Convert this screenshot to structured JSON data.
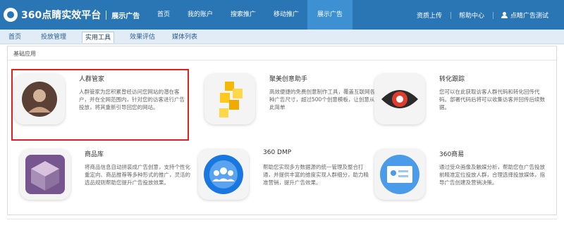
{
  "header": {
    "brand": "360点睛实效平台",
    "sub_brand": "展示广告",
    "nav": [
      {
        "label": "首页"
      },
      {
        "label": "我的账户"
      },
      {
        "label": "搜索推广"
      },
      {
        "label": "移动推广"
      },
      {
        "label": "展示广告",
        "active": true
      }
    ],
    "right": {
      "upload_label": "资质上传",
      "help_label": "帮助中心",
      "user_label": "点睛广告测试"
    }
  },
  "subnav": {
    "items": [
      {
        "label": "首页"
      },
      {
        "label": "投放管理"
      },
      {
        "label": "实用工具",
        "active": true
      },
      {
        "label": "效果评估"
      },
      {
        "label": "媒体列表"
      }
    ]
  },
  "section": {
    "title": "基础应用",
    "cards": [
      {
        "title": "人群管家",
        "icon": "person-avatar-icon",
        "desc": "人群管家为您积累曾经访问您网站的潜在客户，并在全网范围内，针对您的访客进行广告投放，将其重新引导回您的网站。"
      },
      {
        "title": "聚美创意助手",
        "icon": "puzzle-blocks-icon",
        "desc": "高效便捷的免费创意制作工具，覆盖互联网各种广告尺寸，超过500个创意模板，让创意从此简单"
      },
      {
        "title": "转化跟踪",
        "icon": "eye-icon",
        "desc": "您可以在此获取访客人群代码和转化回传代码。部署代码后将可以收集访客并回传后续数据。"
      },
      {
        "title": "商品库",
        "icon": "cube-box-icon",
        "desc": "将商品信息自动拼装成广告创意，支持个性化重定向、商品推荐等多种形式的推广，灵活的选品规则帮助您提升广告投放效果。"
      },
      {
        "title": "360 DMP",
        "icon": "people-group-icon",
        "desc": "帮助您实现多方数据源的统一管理及整合打通，并提供丰富的维度实现人群细分，助力精准营销，提升广告效果。"
      },
      {
        "title": "360商易",
        "icon": "id-card-icon",
        "desc": "通过受众画像及触媒分析，帮助您在广告投放前精准定位投放人群，合理选择投放媒体，指导广告创建及营销决策。"
      }
    ]
  },
  "colors": {
    "header_bg": "#2a75b3",
    "active_nav": "#3d91d2",
    "subnav_bg": "#e1ecf6",
    "highlight": "#e21f1f"
  }
}
